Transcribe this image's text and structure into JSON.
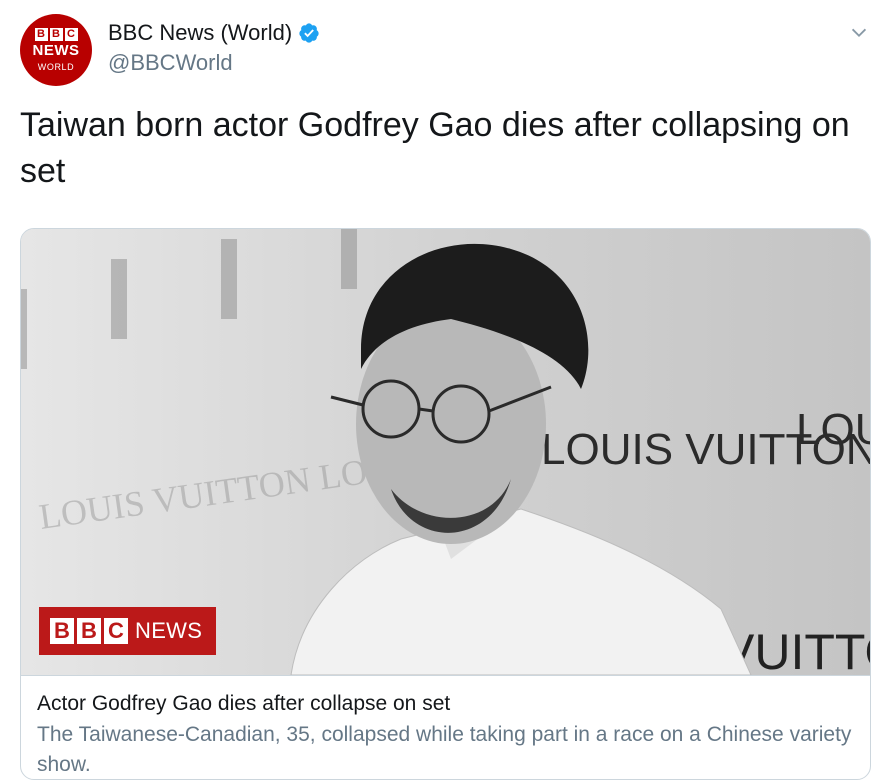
{
  "author": {
    "display_name": "BBC News (World)",
    "handle": "@BBCWorld",
    "avatar": {
      "letters": [
        "B",
        "B",
        "C"
      ],
      "news": "NEWS",
      "world": "WORLD"
    },
    "verified_icon": "verified-badge-icon"
  },
  "tweet": {
    "text": "Taiwan born actor Godfrey Gao dies after collapsing on set"
  },
  "card": {
    "image_badge": {
      "letters": [
        "B",
        "B",
        "C"
      ],
      "news": "NEWS"
    },
    "backdrop_text": {
      "large": "LOUIS VUITTON",
      "right": "LOU",
      "bottom": "VUITTON"
    },
    "title": "Actor Godfrey Gao dies after collapse on set",
    "description": "The Taiwanese-Canadian, 35, collapsed while taking part in a race on a Chinese variety show."
  },
  "colors": {
    "bbc_red": "#bb1919",
    "verified_blue": "#1da1f2",
    "secondary_text": "#657786",
    "border": "#ccd6dd"
  }
}
